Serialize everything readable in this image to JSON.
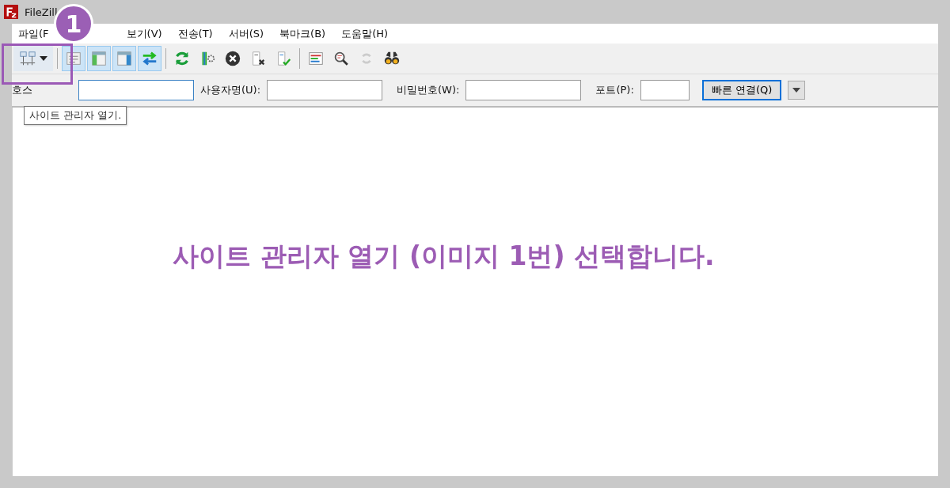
{
  "window": {
    "title": "FileZill"
  },
  "menu": [
    {
      "label": "파일(F"
    },
    {
      "label": "보기(V)"
    },
    {
      "label": "전송(T)"
    },
    {
      "label": "서버(S)"
    },
    {
      "label": "북마크(B)"
    },
    {
      "label": "도움말(H)"
    }
  ],
  "toolbar": [
    {
      "kind": "site-manager",
      "selected": false,
      "disabled": false
    },
    {
      "kind": "separator"
    },
    {
      "kind": "message-log",
      "selected": true,
      "disabled": false
    },
    {
      "kind": "local-tree",
      "selected": true,
      "disabled": false
    },
    {
      "kind": "remote-tree",
      "selected": true,
      "disabled": false
    },
    {
      "kind": "transfer-queue",
      "selected": true,
      "disabled": false
    },
    {
      "kind": "separator"
    },
    {
      "kind": "refresh",
      "selected": false,
      "disabled": false
    },
    {
      "kind": "process-queue",
      "selected": false,
      "disabled": false
    },
    {
      "kind": "cancel",
      "selected": false,
      "disabled": false
    },
    {
      "kind": "disconnect",
      "selected": false,
      "disabled": false
    },
    {
      "kind": "reconnect",
      "selected": false,
      "disabled": false
    },
    {
      "kind": "separator"
    },
    {
      "kind": "filters",
      "selected": false,
      "disabled": false
    },
    {
      "kind": "compare",
      "selected": false,
      "disabled": false
    },
    {
      "kind": "sync",
      "selected": false,
      "disabled": true
    },
    {
      "kind": "search",
      "selected": false,
      "disabled": false
    }
  ],
  "quickconnect": {
    "host_label": "호스",
    "username_label": "사용자명(U):",
    "password_label": "비밀번호(W):",
    "port_label": "포트(P):",
    "connect_button": "빠른 연결(Q)"
  },
  "tooltip": {
    "text": "사이트 관리자 열기."
  },
  "annotation": {
    "badge": "1",
    "caption": "사이트 관리자 열기 (이미지 1번) 선택합니다."
  }
}
